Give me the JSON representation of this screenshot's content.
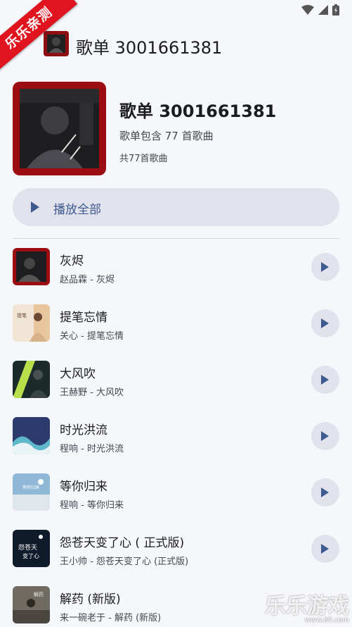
{
  "ribbon": {
    "label": "乐乐亲测"
  },
  "app_bar": {
    "title": "歌单 3001661381"
  },
  "playlist": {
    "title": "歌单 3001661381",
    "description": "歌单包含 77 首歌曲",
    "count": "共77首歌曲"
  },
  "play_all": {
    "label": "播放全部"
  },
  "songs": [
    {
      "title": "灰烬",
      "subtitle": "赵品霖 - 灰烬"
    },
    {
      "title": "提笔忘情",
      "subtitle": "关心 - 提笔忘情"
    },
    {
      "title": "大风吹",
      "subtitle": "王赫野 - 大风吹"
    },
    {
      "title": "时光洪流",
      "subtitle": "程响 - 时光洪流"
    },
    {
      "title": "等你归来",
      "subtitle": "程响 - 等你归来"
    },
    {
      "title": "怨苍天变了心 ( 正式版)",
      "subtitle": "王小帅 - 怨苍天变了心 (正式版)"
    },
    {
      "title": "解药 (新版)",
      "subtitle": "来一碗老于 - 解药 (新版)"
    }
  ],
  "watermark": {
    "text": "乐乐游戏",
    "url": "www.6ll.com"
  },
  "colors": {
    "accent": "#3f5a8f",
    "ribbon": "#e0141f",
    "button_bg": "#e1e2ec"
  }
}
